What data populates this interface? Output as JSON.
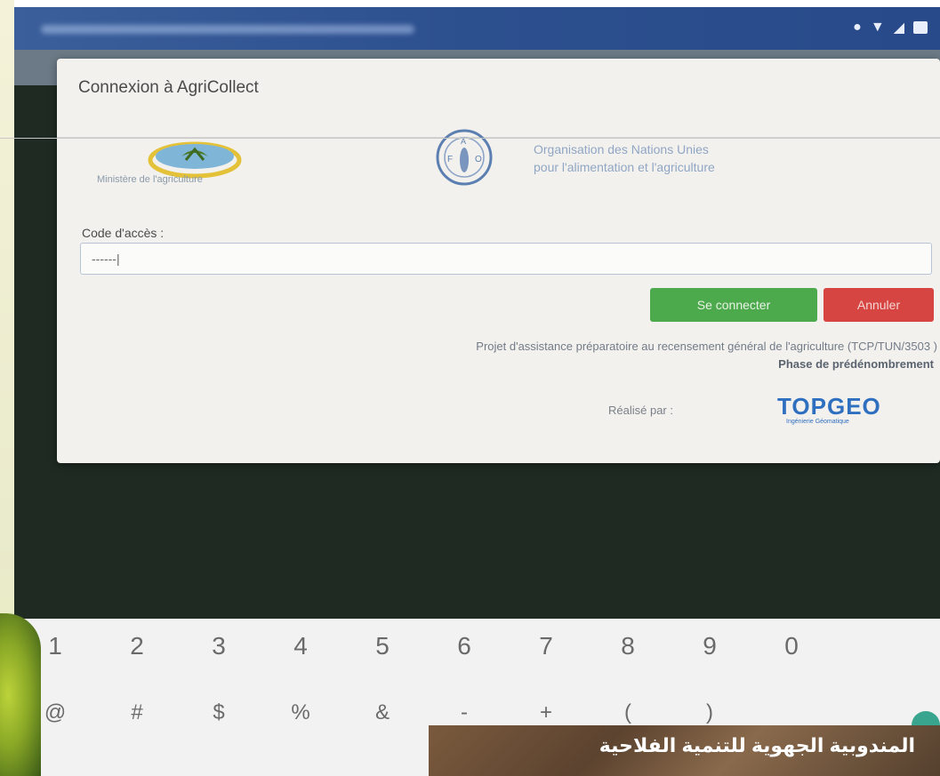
{
  "dialog": {
    "title": "Connexion à AgriCollect",
    "ministry_caption": "Ministère de l'agriculture",
    "fao_line1": "Organisation des Nations Unies",
    "fao_line2": "pour l'alimentation et l'agriculture",
    "code_label": "Code d'accès :",
    "code_value": "------|",
    "connect_label": "Se connecter",
    "cancel_label": "Annuler",
    "project_text": "Projet d'assistance préparatoire au recensement général de l'agriculture (TCP/TUN/3503 )",
    "phase_text": "Phase de prédénombrement",
    "realise_label": "Réalisé par :",
    "company_name": "TOPGEO",
    "company_tagline": "Ingénierie Géomatique"
  },
  "keyboard": {
    "numbers": [
      "1",
      "2",
      "3",
      "4",
      "5",
      "6",
      "7",
      "8",
      "9",
      "0"
    ],
    "symbols": [
      "@",
      "#",
      "$",
      "%",
      "&",
      "-",
      "+",
      "(",
      ")"
    ]
  },
  "banner": {
    "text": "المندوبية الجهوية للتنمية الفلاحية"
  },
  "colors": {
    "connect": "#4daa4c",
    "cancel": "#d64541",
    "status_bar": "#2c4f8e"
  }
}
